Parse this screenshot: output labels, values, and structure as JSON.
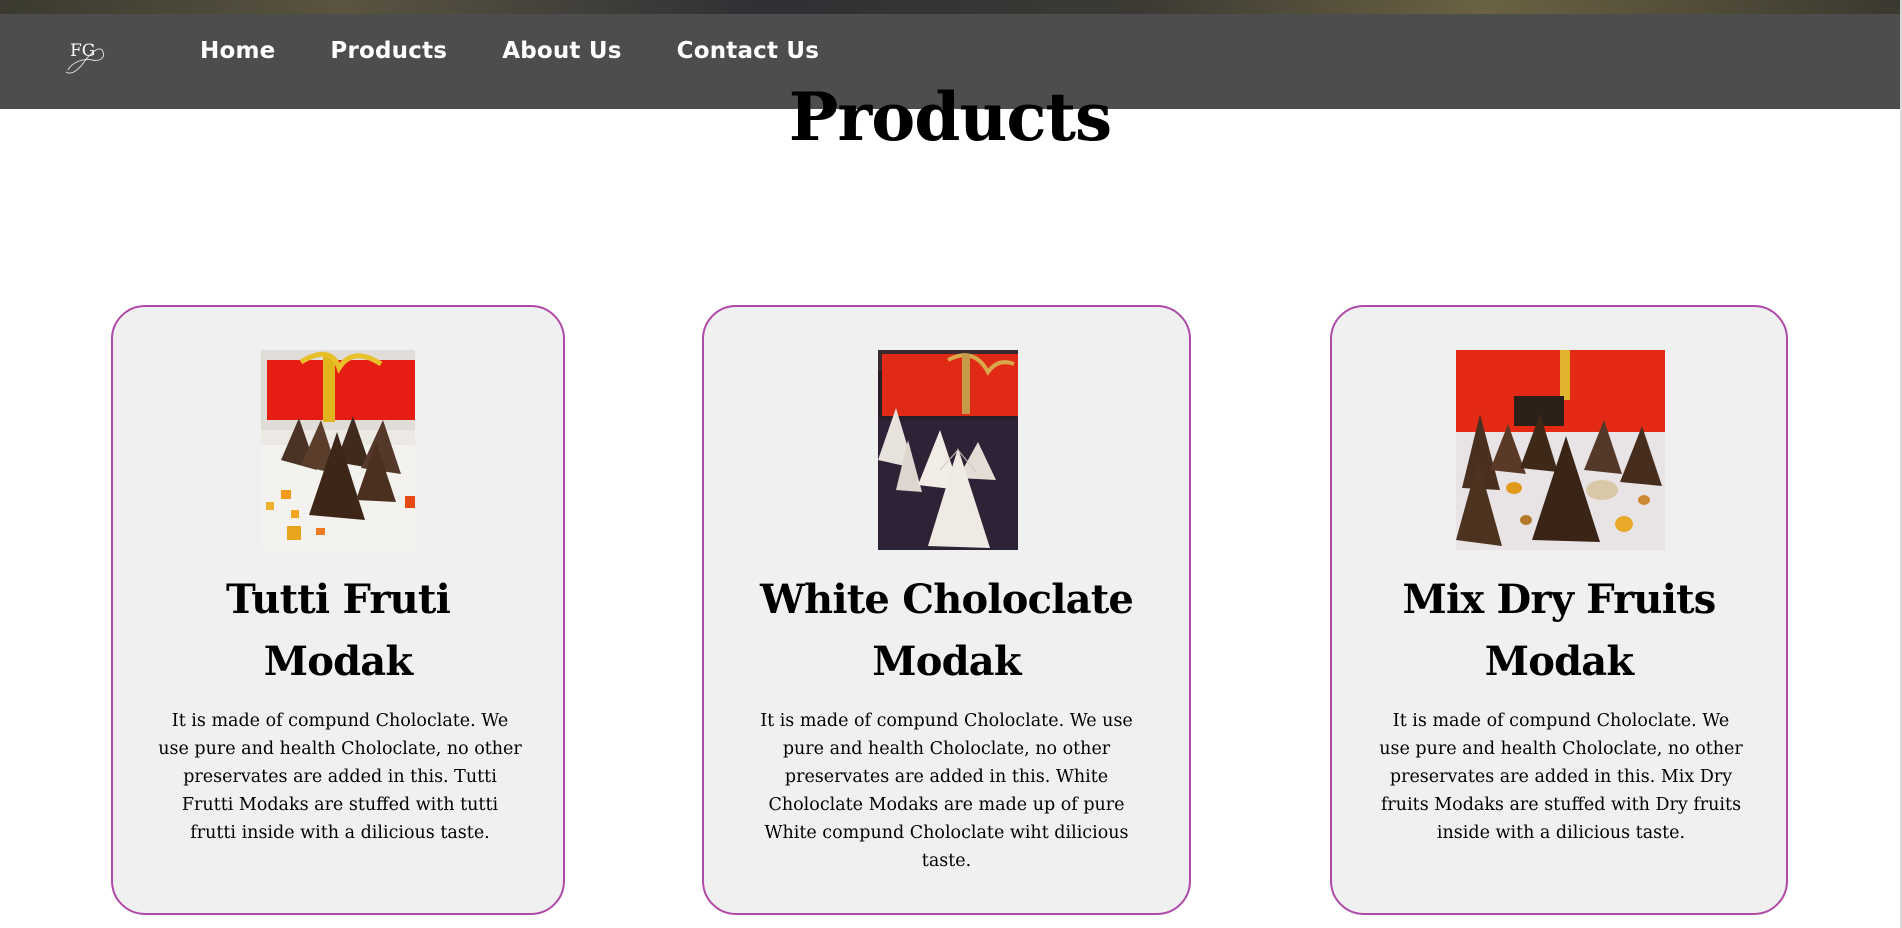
{
  "logo": {
    "text": "FG",
    "icon": "fg-monogram-logo"
  },
  "nav": {
    "items": [
      {
        "label": "Home"
      },
      {
        "label": "Products"
      },
      {
        "label": "About Us"
      },
      {
        "label": "Contact Us"
      }
    ]
  },
  "products": {
    "title": "Products",
    "cards": [
      {
        "name": "Tutti Fruti Modak",
        "image": "chocolate-modaks-with-tutti-frutti-photo",
        "description": "It is made of compund Choloclate. We use pure and health Choloclate, no other preservates are added in this. Tutti Frutti Modaks are stuffed with tutti frutti inside with a dilicious taste."
      },
      {
        "name": "White Choloclate Modak",
        "image": "white-chocolate-modaks-photo",
        "description": "It is made of compund Choloclate. We use pure and health Choloclate, no other preservates are added in this. White Choloclate Modaks are made up of pure White compund Choloclate wiht dilicious taste."
      },
      {
        "name": "Mix Dry Fruits Modak",
        "image": "dry-fruit-chocolate-modaks-photo",
        "description": "It is made of compund Choloclate. We use pure and health Choloclate, no other preservates are added in this. Mix Dry fruits Modaks are stuffed with Dry fruits inside with a dilicious taste."
      }
    ]
  },
  "colors": {
    "navbar_bg": "#4d4d4d",
    "card_bg": "#f0f0f0",
    "card_border": "#b04aa8",
    "text": "#000000",
    "nav_text": "#ffffff"
  }
}
